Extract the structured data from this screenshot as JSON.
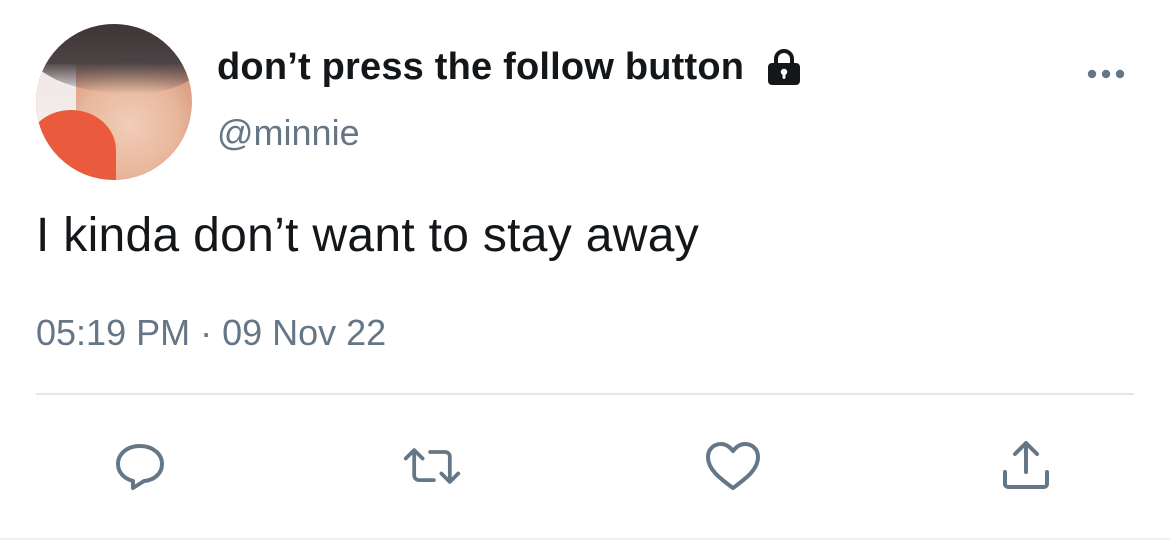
{
  "tweet": {
    "display_name": "don’t press the follow button",
    "handle": "@minnie",
    "text": "I kinda don’t want to stay away",
    "time": "05:19 PM",
    "separator": "·",
    "date": "09 Nov 22",
    "protected_icon": "lock-icon",
    "more_icon": "more-horizontal-icon"
  },
  "actions": [
    {
      "id": "reply",
      "icon": "reply-icon"
    },
    {
      "id": "retweet",
      "icon": "retweet-icon"
    },
    {
      "id": "like",
      "icon": "heart-icon"
    },
    {
      "id": "share",
      "icon": "share-icon"
    }
  ],
  "colors": {
    "text_primary": "#14171a",
    "text_secondary": "#657786",
    "divider": "#e1e8ed"
  }
}
